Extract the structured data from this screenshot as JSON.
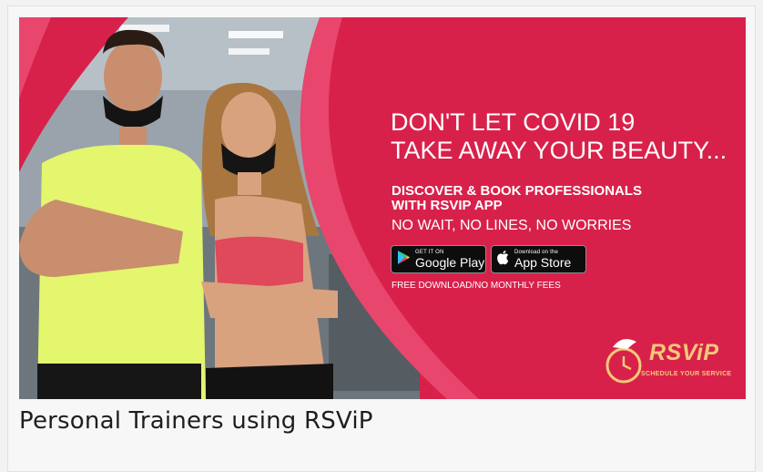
{
  "banner": {
    "headline_lines": [
      "DON'T LET COVID 19",
      "TAKE AWAY YOUR BEAUTY..."
    ],
    "sub_bold_lines": [
      "DISCOVER & BOOK PROFESSIONALS",
      "WITH RSVIP APP"
    ],
    "sub_plain": "NO WAIT, NO LINES, NO WORRIES",
    "google_play": {
      "small": "GET IT ON",
      "big": "Google Play"
    },
    "app_store": {
      "small": "Download on the",
      "big": "App Store"
    },
    "fees": "FREE DOWNLOAD/NO MONTHLY FEES",
    "logo": {
      "name": "RSViP",
      "tagline": "SCHEDULE YOUR SERVICE"
    },
    "colors": {
      "brand_red": "#d8214a",
      "accent_pink": "#e8466d",
      "logo_gold": "#f3c97a"
    }
  },
  "caption": "Personal Trainers using RSViP"
}
